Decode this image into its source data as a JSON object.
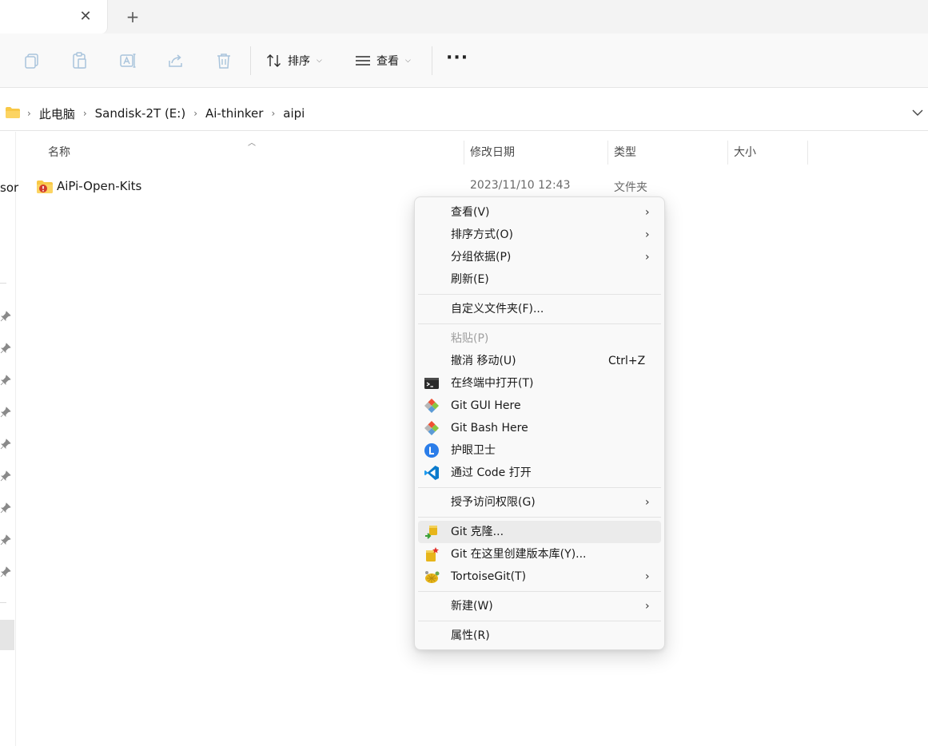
{
  "tabs": {
    "close_glyph": "✕",
    "new_tab_glyph": "+"
  },
  "toolbar": {
    "sort_label": "排序",
    "view_label": "查看",
    "more_glyph": "···"
  },
  "breadcrumb": {
    "items": [
      "此电脑",
      "Sandisk-2T (E:)",
      "Ai-thinker",
      "aipi"
    ],
    "separator": "›"
  },
  "left_pane": {
    "partial_text": "sor"
  },
  "columns": {
    "name": "名称",
    "modified": "修改日期",
    "type": "类型",
    "size": "大小"
  },
  "file": {
    "name": "AiPi-Open-Kits",
    "modified": "2023/11/10 12:43",
    "type": "文件夹"
  },
  "context_menu": {
    "view": "查看(V)",
    "sort_by": "排序方式(O)",
    "group_by": "分组依据(P)",
    "refresh": "刷新(E)",
    "customize": "自定义文件夹(F)...",
    "paste": "粘贴(P)",
    "undo": "撤消 移动(U)",
    "undo_shortcut": "Ctrl+Z",
    "terminal": "在终端中打开(T)",
    "git_gui": "Git GUI Here",
    "git_bash": "Git Bash Here",
    "eye_guard": "护眼卫士",
    "vscode": "通过 Code 打开",
    "grant_access": "授予访问权限(G)",
    "git_clone": "Git 克隆...",
    "git_create_repo": "Git 在这里创建版本库(Y)...",
    "tortoisegit": "TortoiseGit(T)",
    "new": "新建(W)",
    "properties": "属性(R)",
    "submenu_arrow": "›"
  },
  "colors": {
    "accent": "#0078d4",
    "folder": "#f8c846",
    "vscode": "#0a7acc",
    "git": "#f05033"
  }
}
